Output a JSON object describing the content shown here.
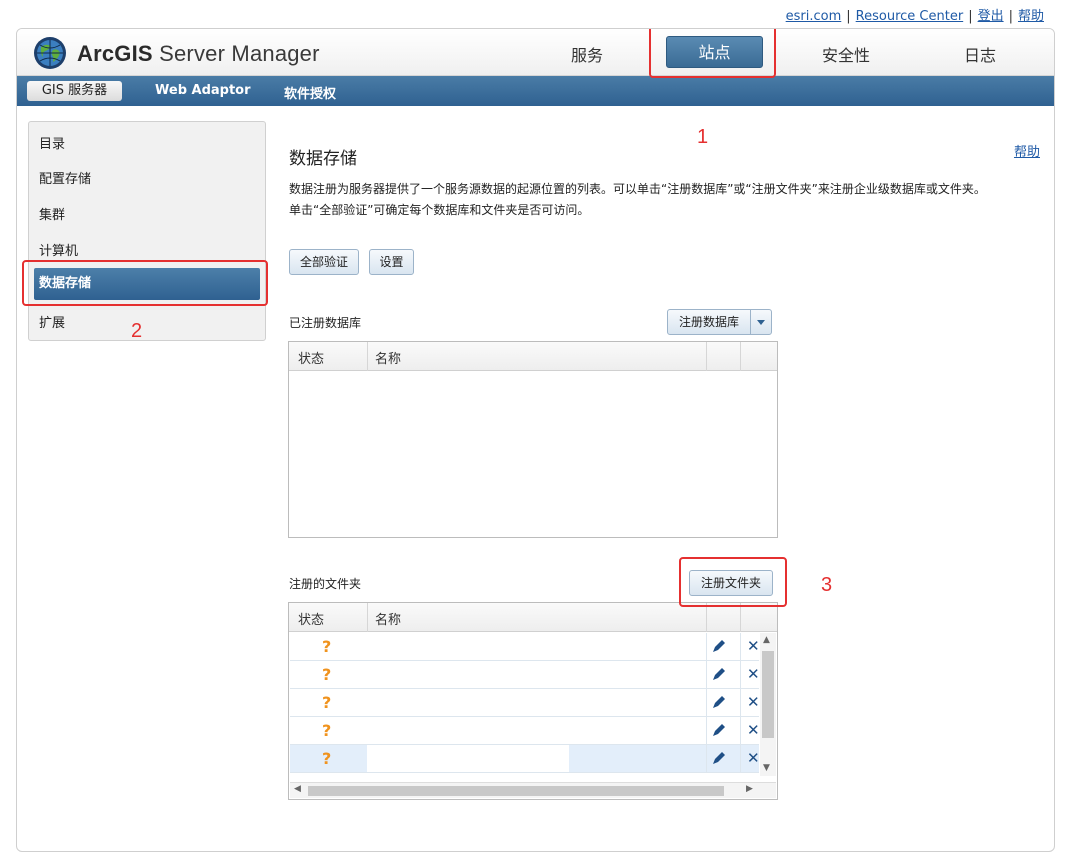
{
  "top_links": {
    "esri": "esri.com",
    "resource_center": "Resource Center",
    "logout": "登出",
    "help": "帮助",
    "sep": "|"
  },
  "header": {
    "app_title_bold": "ArcGIS",
    "app_title_rest": " Server Manager",
    "tabs": [
      {
        "label": "服务",
        "active": false
      },
      {
        "label": "站点",
        "active": true
      },
      {
        "label": "安全性",
        "active": false
      },
      {
        "label": "日志",
        "active": false
      }
    ]
  },
  "subnav": {
    "items": [
      {
        "label": "GIS 服务器",
        "active": true
      },
      {
        "label": "Web Adaptor",
        "active": false
      },
      {
        "label": "软件授权",
        "active": false
      }
    ]
  },
  "sidebar": {
    "items": [
      {
        "label": "目录",
        "active": false
      },
      {
        "label": "配置存储",
        "active": false
      },
      {
        "label": "集群",
        "active": false
      },
      {
        "label": "计算机",
        "active": false
      },
      {
        "label": "数据存储",
        "active": true
      },
      {
        "label": "扩展",
        "active": false
      }
    ]
  },
  "main": {
    "title": "数据存储",
    "help": "帮助",
    "description_line1": "数据注册为服务器提供了一个服务源数据的起源位置的列表。可以单击“注册数据库”或“注册文件夹”来注册企业级数据库或文件夹。",
    "description_line2": "单击“全部验证”可确定每个数据库和文件夹是否可访问。",
    "validate_all": "全部验证",
    "settings": "设置",
    "databases": {
      "label": "已注册数据库",
      "register_button": "注册数据库",
      "columns": [
        "状态",
        "名称"
      ]
    },
    "folders": {
      "label": "注册的文件夹",
      "register_button": "注册文件夹",
      "columns": [
        "状态",
        "名称"
      ],
      "rows": [
        {
          "status": "?",
          "selected": false
        },
        {
          "status": "?",
          "selected": false
        },
        {
          "status": "?",
          "selected": false
        },
        {
          "status": "?",
          "selected": false
        },
        {
          "status": "?",
          "selected": true
        }
      ]
    }
  },
  "annotations": [
    "1",
    "2",
    "3"
  ],
  "colors": {
    "nav_blue": "#2f6191",
    "annotation_red": "#e53030",
    "status_unknown": "#f0931e"
  },
  "icons": {
    "logo": "globe-logo-icon",
    "edit": "pencil-icon",
    "delete": "close-icon",
    "dropdown": "chevron-down-icon"
  }
}
